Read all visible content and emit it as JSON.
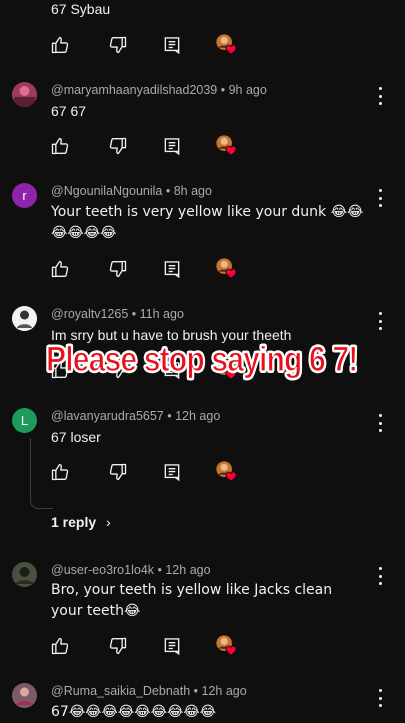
{
  "comments": [
    {
      "author": "",
      "time": "",
      "text": "67 Sybau",
      "avatar_letter": "",
      "avatar_color": "#333333"
    },
    {
      "author": "@maryamhaanyadilshad2039",
      "time": "9h ago",
      "text": "67 67",
      "avatar_letter": "",
      "avatar_color": "#7a2a44"
    },
    {
      "author": "@NgounilaNgounila",
      "time": "8h ago",
      "text": "Your teeth is very yellow like your dunk 😂😂😂😂😂😂",
      "avatar_letter": "r",
      "avatar_color": "#8e24aa"
    },
    {
      "author": "@royaltv1265",
      "time": "11h ago",
      "text": "Im srry but u have to brush your theeth",
      "avatar_letter": "",
      "avatar_color": "#e0e0e0"
    },
    {
      "author": "@lavanyarudra5657",
      "time": "12h ago",
      "text": "67 loser",
      "avatar_letter": "L",
      "avatar_color": "#1e9a5a"
    },
    {
      "author": "@user-eo3ro1lo4k",
      "time": "12h ago",
      "text": "Bro, your teeth is yellow like Jacks clean your teeth😂",
      "avatar_letter": "",
      "avatar_color": "#3a3f2e"
    },
    {
      "author": "@Ruma_saikia_Debnath",
      "time": "12h ago",
      "text": "67😂😂😂😂😂😂😂😂😂",
      "avatar_letter": "",
      "avatar_color": "#6b4a5a"
    }
  ],
  "replies_label": "1 reply",
  "overlay_caption": "Please stop saying 6 7!",
  "icons": {
    "like": "thumbs-up-icon",
    "dislike": "thumbs-down-icon",
    "reply": "reply-icon",
    "creator_heart": "creator-heart-icon",
    "more": "more-vert-icon"
  },
  "colors": {
    "background": "#0f0f0f",
    "meta_text": "#aaaaaa",
    "caption_red": "#e8101b",
    "heart_red": "#ff0033"
  }
}
